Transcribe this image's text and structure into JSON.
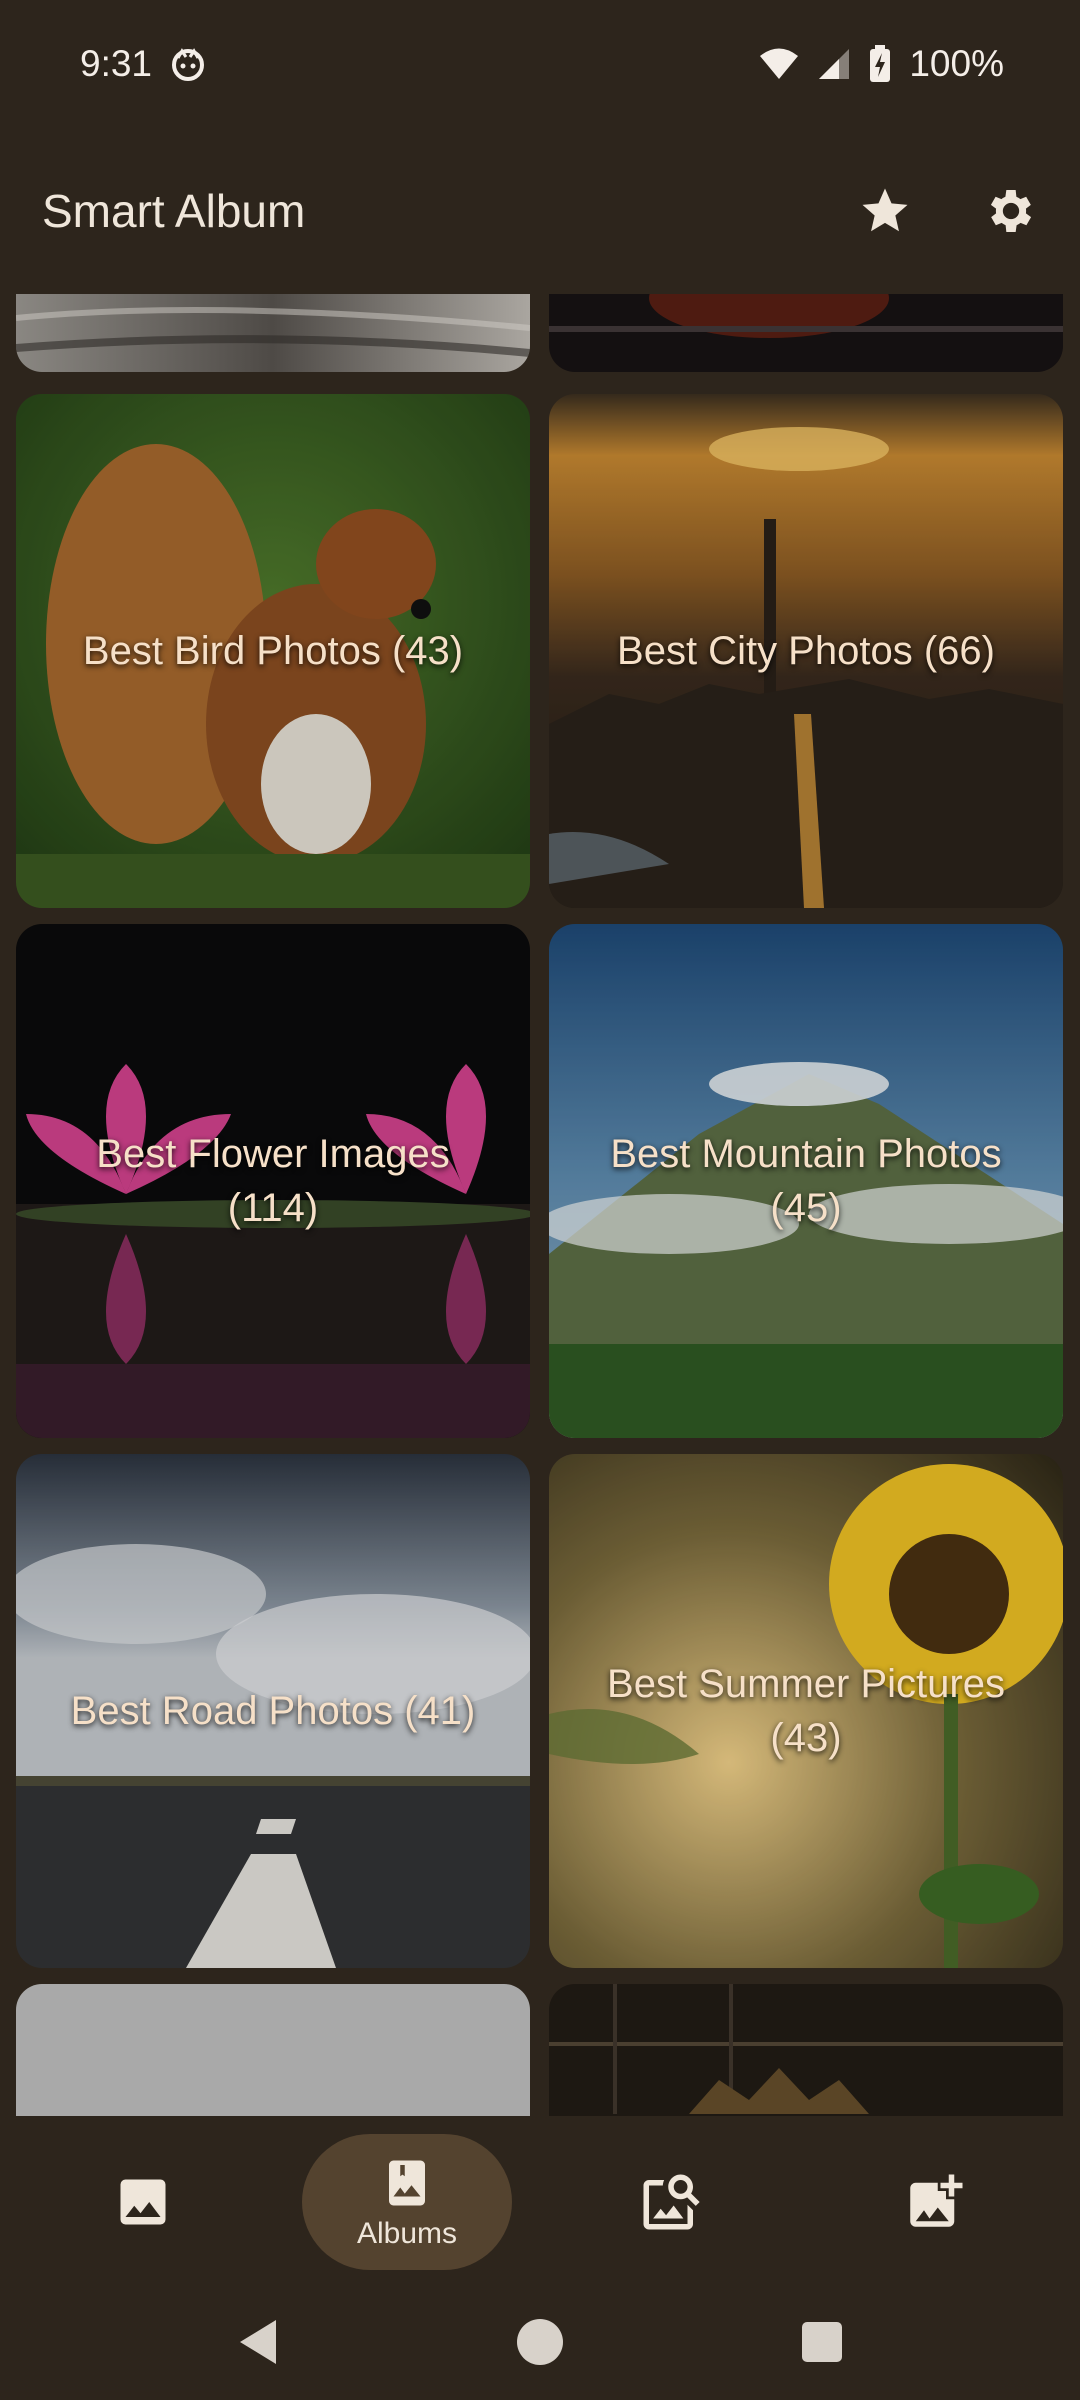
{
  "status_bar": {
    "time": "9:31",
    "battery": "100%",
    "icons": [
      "face-icon",
      "wifi-icon",
      "signal-icon",
      "battery-charging-icon"
    ]
  },
  "app_bar": {
    "title": "Smart Album",
    "actions": [
      "star-icon",
      "gear-icon"
    ]
  },
  "albums": [
    {
      "label": "Best Bird Photos (43)"
    },
    {
      "label": "Best City Photos (66)"
    },
    {
      "label": "Best Flower Images (114)"
    },
    {
      "label": "Best Mountain Photos (45)"
    },
    {
      "label": "Best Road Photos (41)"
    },
    {
      "label": "Best Summer Pictures (43)"
    }
  ],
  "bottom_nav": {
    "items": [
      {
        "icon": "photos-icon",
        "label": ""
      },
      {
        "icon": "albums-icon",
        "label": "Albums"
      },
      {
        "icon": "image-search-icon",
        "label": ""
      },
      {
        "icon": "add-photo-icon",
        "label": ""
      }
    ],
    "active": "Albums"
  },
  "system_nav": [
    "back-icon",
    "home-icon",
    "recents-icon"
  ],
  "colors": {
    "background": "#2d251c",
    "active_pill": "#54432f",
    "label_text": "#f6e0c8"
  }
}
